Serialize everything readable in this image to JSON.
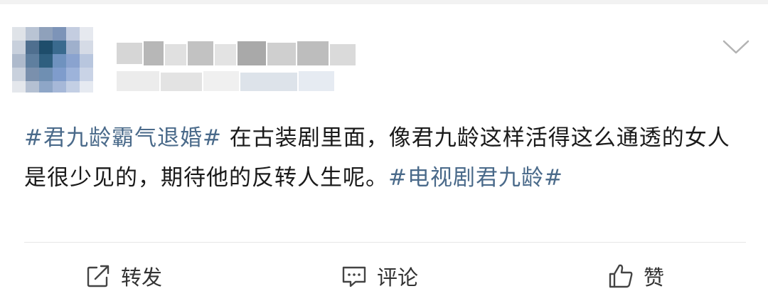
{
  "post": {
    "tag1": "#君九龄霸气退婚#",
    "text": " 在古装剧里面，像君九龄这样活得这么通透的女人是很少见的，期待他的反转人生呢。",
    "tag2": "#电视剧君九龄#"
  },
  "actions": {
    "repost_label": "转发",
    "comment_label": "评论",
    "like_label": "赞"
  },
  "icons": {
    "menu": "chevron-down-icon",
    "repost": "edit-share-icon",
    "comment": "comment-bubble-icon",
    "like": "thumbs-up-icon"
  },
  "colors": {
    "hashtag": "#4a6a8a",
    "text": "#1a1a1a",
    "divider": "#e6e6e6"
  }
}
